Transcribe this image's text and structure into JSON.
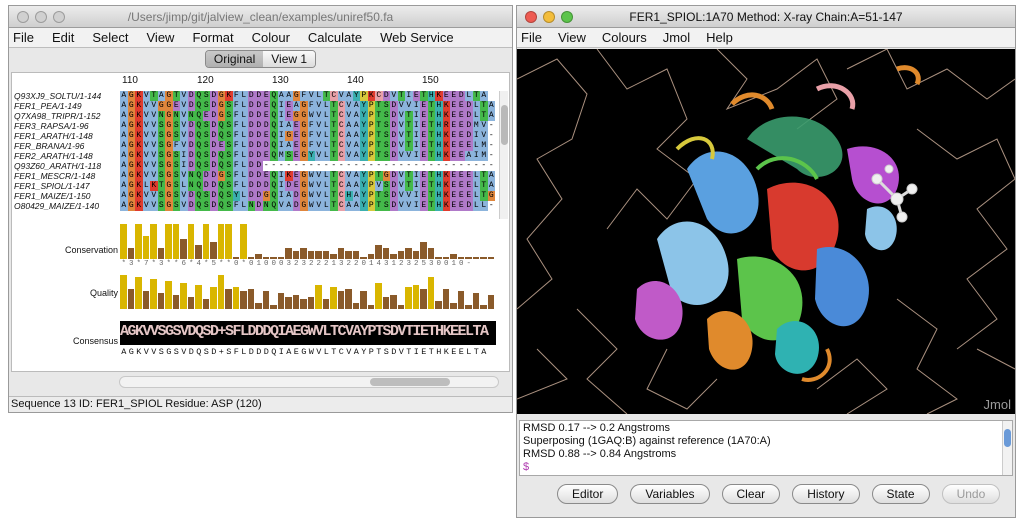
{
  "left": {
    "title": "/Users/jimp/git/jalview_clean/examples/uniref50.fa",
    "menu": [
      "File",
      "Edit",
      "Select",
      "View",
      "Format",
      "Colour",
      "Calculate",
      "Web Service"
    ],
    "tabs": [
      "Original",
      "View 1"
    ],
    "ruler": [
      "110",
      "120",
      "130",
      "140",
      "150"
    ],
    "seq_names": [
      "Q93XJ9_SOLTU/1-144",
      "FER1_PEA/1-149",
      "Q7XA98_TRIPR/1-152",
      "FER3_RAPSA/1-96",
      "FER1_ARATH/1-148",
      "FER_BRANA/1-96",
      "FER2_ARATH/1-148",
      "Q93Z60_ARATH/1-118",
      "FER1_MESCR/1-148",
      "FER1_SPIOL/1-147",
      "FER1_MAIZE/1-150",
      "O80429_MAIZE/1-140"
    ],
    "seqs": [
      "AGKVTAGTVDQSDGKFLDDEQAAGFVLTCVAYPKCDVTIETHKEEDLTA",
      "AGKVVGGEVDQSDGSFLDDEQIEAGFVLTCVAYPTSDVVIETHKEEDLTA",
      "AGKVVNGNVNQEDGSFLDDEQIEGGWVLTCVAYPTSDVTIETHKEEDLTA",
      "AGKVVSGSVDQSDQSFLDDDQIAEGFVLTCAAYPTSDVTIETHREEDMV-",
      "AGKVVSGSVDQSDQSFLDDEQIGEGFVLTCAAYPTSDVTIETHKEEDIV-",
      "AGKVVSGFVDQSDESFLDDDQIAEGFVLTCVAYPTSDVTIETHKEEELM-",
      "AGKVVSGSIDQSDQSFLDDEQMSEGYVLTCVAYPTSDVVIETHKEEAIM-",
      "AGKVVSGSIDQSDQSFLDD-------------------------------",
      "AGKVVSGSVNQDDGSFLDDEQIKEGWVLTCVAYPTGDVTIETHKEEELTA",
      "AGKLKTGSLNQDDQSFLDDDQIDEGWVLTCAAYPVSDVTIETHKEEELTA",
      "AGKVVSGSVDQSDQSYLDDGQIADGWVLTCHAYPTSDVVIETHKEEELTG",
      "AGKVVSGSVDQSDQSFLNDNQVADGWVLTCAAYPTSDVVIETHKEEDLL-"
    ],
    "annot_labels": [
      "Conservation",
      "Quality",
      "Consensus"
    ],
    "cons_digits": "*3*7*3**6*4*5**0*01000323222132201431232530010-",
    "consensus_seq": "AGKVVSGSVDQSD+SFLDDDQIAEGWVLTCVAYPTSDVTIETHKEELTA",
    "status": "Sequence 13 ID: FER1_SPIOL  Residue: ASP (120)"
  },
  "right": {
    "title": "FER1_SPIOL:1A70 Method: X-ray Chain:A=51-147",
    "menu": [
      "File",
      "View",
      "Colours",
      "Jmol",
      "Help"
    ],
    "watermark": "Jmol",
    "console": [
      "RMSD 0.17 --> 0.2 Angstroms",
      "Superposing (1GAQ:B) against reference (1A70:A)",
      "RMSD 0.88 --> 0.84 Angstroms",
      "$"
    ],
    "buttons": [
      "Editor",
      "Variables",
      "Clear",
      "History",
      "State",
      "Undo"
    ]
  },
  "colors": {
    "background_3d": "#000000",
    "residue": {
      "A": "#8cb4dc",
      "G": "#e0863c",
      "K": "#e03b2e",
      "V": "#8cb4dc",
      "T": "#44b94a",
      "D": "#b07ac9",
      "Q": "#44b94a",
      "S": "#44b94a",
      "F": "#8cb4dc",
      "L": "#8cb4dc",
      "E": "#b07ac9",
      "I": "#8cb4dc",
      "C": "#e9a0a8",
      "Y": "#3bb0b0",
      "P": "#d7c93c",
      "H": "#3bb0b0",
      "W": "#8cb4dc",
      "N": "#44b94a",
      "R": "#e03b2e",
      "M": "#8cb4dc",
      "-": "#ffffff"
    }
  }
}
